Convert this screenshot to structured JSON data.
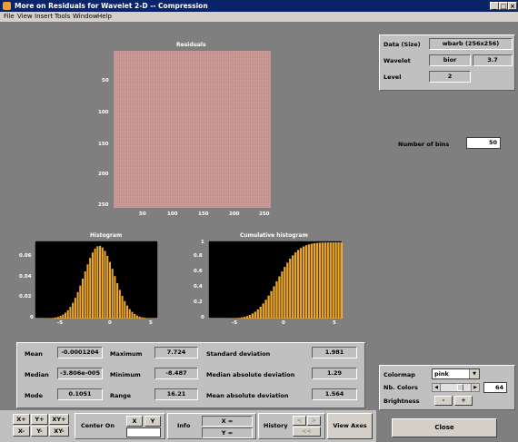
{
  "window": {
    "title": "More on Residuals for Wavelet 2-D  --  Compression"
  },
  "menu": [
    "File",
    "View",
    "Insert",
    "Tools",
    "Window",
    "Help"
  ],
  "residuals": {
    "title": "Residuals",
    "yticks": [
      "50",
      "100",
      "150",
      "200",
      "250"
    ],
    "xticks": [
      "50",
      "100",
      "150",
      "200",
      "250"
    ]
  },
  "histogram": {
    "title": "Histogram",
    "yticks": [
      "0.06",
      "0.04",
      "0.02",
      "0"
    ],
    "xticks": [
      "-5",
      "0",
      "5"
    ]
  },
  "cumulative": {
    "title": "Cumulative histogram",
    "yticks": [
      "1",
      "0.8",
      "0.6",
      "0.4",
      "0.2",
      "0"
    ],
    "xticks": [
      "-5",
      "0",
      "5"
    ]
  },
  "stats": {
    "mean_label": "Mean",
    "mean": "-0.0001204",
    "median_label": "Median",
    "median": "-3.806e-005",
    "mode_label": "Mode",
    "mode": "0.1051",
    "max_label": "Maximum",
    "max": "7.724",
    "min_label": "Minimum",
    "min": "-8.487",
    "range_label": "Range",
    "range": "16.21",
    "std_label": "Standard deviation",
    "std": "1.981",
    "medad_label": "Median absolute deviation",
    "medad": "1.29",
    "meanad_label": "Mean absolute deviation",
    "meanad": "1.564"
  },
  "info": {
    "data_label": "Data (Size)",
    "data_value": "wbarb  (256x256)",
    "wavelet_label": "Wavelet",
    "wavelet_family": "bior",
    "wavelet_number": "3.7",
    "level_label": "Level",
    "level_value": "2"
  },
  "bins": {
    "label": "Number of bins",
    "value": "50"
  },
  "colormap": {
    "label": "Colormap",
    "value": "pink",
    "nbcolors_label": "Nb. Colors",
    "nbcolors_value": "64",
    "brightness_label": "Brightness",
    "minus": "-",
    "plus": "+"
  },
  "toolbar": {
    "xplus": "X+",
    "yplus": "Y+",
    "xyplus": "XY+",
    "xminus": "X-",
    "yminus": "Y-",
    "xyminus": "XY-",
    "center_on": "Center On",
    "center_x": "X",
    "center_y": "Y",
    "info": "Info",
    "x_eq": "X =",
    "y_eq": "Y =",
    "history": "History",
    "view_axes": "View Axes"
  },
  "close_label": "Close"
}
